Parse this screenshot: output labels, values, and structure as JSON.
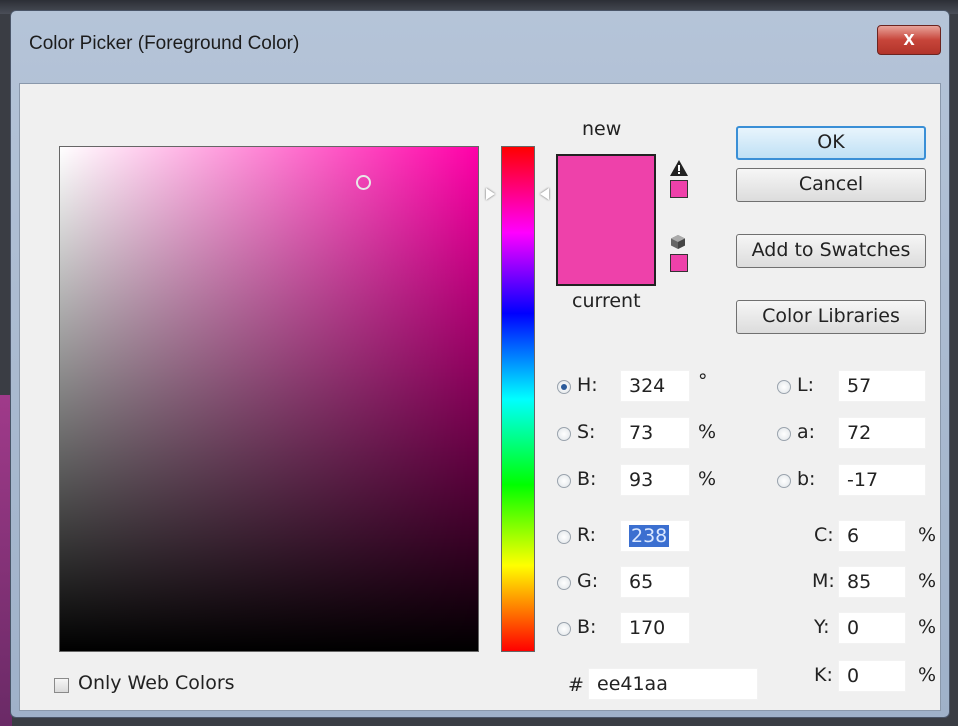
{
  "window": {
    "title": "Color Picker (Foreground Color)",
    "close_label": "x"
  },
  "colors": {
    "new": "#ee41aa",
    "current": "#ee41aa",
    "field_hue": "#ff00a8"
  },
  "swatch": {
    "new_label": "new",
    "current_label": "current"
  },
  "icons": {
    "gamut_warning": "warning-triangle-icon",
    "web_safe": "cube-icon"
  },
  "buttons": {
    "ok": "OK",
    "cancel": "Cancel",
    "add_to_swatches": "Add to Swatches",
    "color_libraries": "Color Libraries"
  },
  "hsb": {
    "h": {
      "label": "H:",
      "value": "324",
      "unit": "°"
    },
    "s": {
      "label": "S:",
      "value": "73",
      "unit": "%"
    },
    "b": {
      "label": "B:",
      "value": "93",
      "unit": "%"
    }
  },
  "rgb": {
    "r": {
      "label": "R:",
      "value": "238"
    },
    "g": {
      "label": "G:",
      "value": "65"
    },
    "b": {
      "label": "B:",
      "value": "170"
    }
  },
  "lab": {
    "l": {
      "label": "L:",
      "value": "57"
    },
    "a": {
      "label": "a:",
      "value": "72"
    },
    "b": {
      "label": "b:",
      "value": "-17"
    }
  },
  "cmyk": {
    "c": {
      "label": "C:",
      "value": "6",
      "unit": "%"
    },
    "m": {
      "label": "M:",
      "value": "85",
      "unit": "%"
    },
    "y": {
      "label": "Y:",
      "value": "0",
      "unit": "%"
    },
    "k": {
      "label": "K:",
      "value": "0",
      "unit": "%"
    }
  },
  "hex": {
    "label": "#",
    "value": "ee41aa"
  },
  "web_colors": {
    "label": "Only Web Colors"
  }
}
